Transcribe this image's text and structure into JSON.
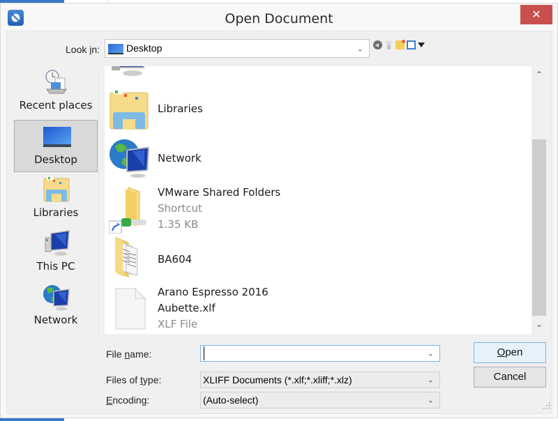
{
  "window": {
    "title": "Open Document",
    "close_label": "✕"
  },
  "look_in": {
    "label_pre": "Look ",
    "label_accel": "i",
    "label_post": "n:",
    "value": "Desktop"
  },
  "toolbar": {
    "icons": [
      "back-icon",
      "up-folder-icon",
      "new-folder-icon",
      "view-menu-icon",
      "dropdown-arrow-icon"
    ]
  },
  "sidebar": {
    "items": [
      {
        "label": "Recent places",
        "icon": "recent-places-icon",
        "selected": false
      },
      {
        "label": "Desktop",
        "icon": "desktop-icon",
        "selected": true
      },
      {
        "label": "Libraries",
        "icon": "libraries-icon",
        "selected": false
      },
      {
        "label": "This PC",
        "icon": "this-pc-icon",
        "selected": false
      },
      {
        "label": "Network",
        "icon": "network-icon",
        "selected": false
      }
    ]
  },
  "files": [
    {
      "name": "Libraries",
      "icon": "libraries-icon",
      "details": []
    },
    {
      "name": "Network",
      "icon": "network-icon",
      "details": []
    },
    {
      "name": "VMware Shared Folders",
      "icon": "shortcut-folder-icon",
      "details": [
        "Shortcut",
        "1.35 KB"
      ]
    },
    {
      "name": "BA604",
      "icon": "folder-icon",
      "details": []
    },
    {
      "name": "Arano Espresso 2016",
      "name2": "Aubette.xlf",
      "icon": "file-icon",
      "details": [
        "XLF File"
      ]
    }
  ],
  "form": {
    "filename_label_pre": "File ",
    "filename_label_accel": "n",
    "filename_label_post": "ame:",
    "filename_value": "",
    "filetype_label_pre": "Files of ",
    "filetype_label_accel": "t",
    "filetype_label_post": "ype:",
    "filetype_value": "XLIFF Documents (*.xlf;*.xliff;*.xlz)",
    "encoding_label_accel": "E",
    "encoding_label_post": "ncoding:",
    "encoding_value": "(Auto-select)"
  },
  "buttons": {
    "open_accel": "O",
    "open_post": "pen",
    "cancel": "Cancel"
  },
  "scrollbar": {
    "up": "⌃",
    "down": "⌄"
  },
  "colors": {
    "close_button": "#c7504f",
    "focus_border": "#7eb4ea",
    "selection_bg": "#d9d9d9"
  }
}
